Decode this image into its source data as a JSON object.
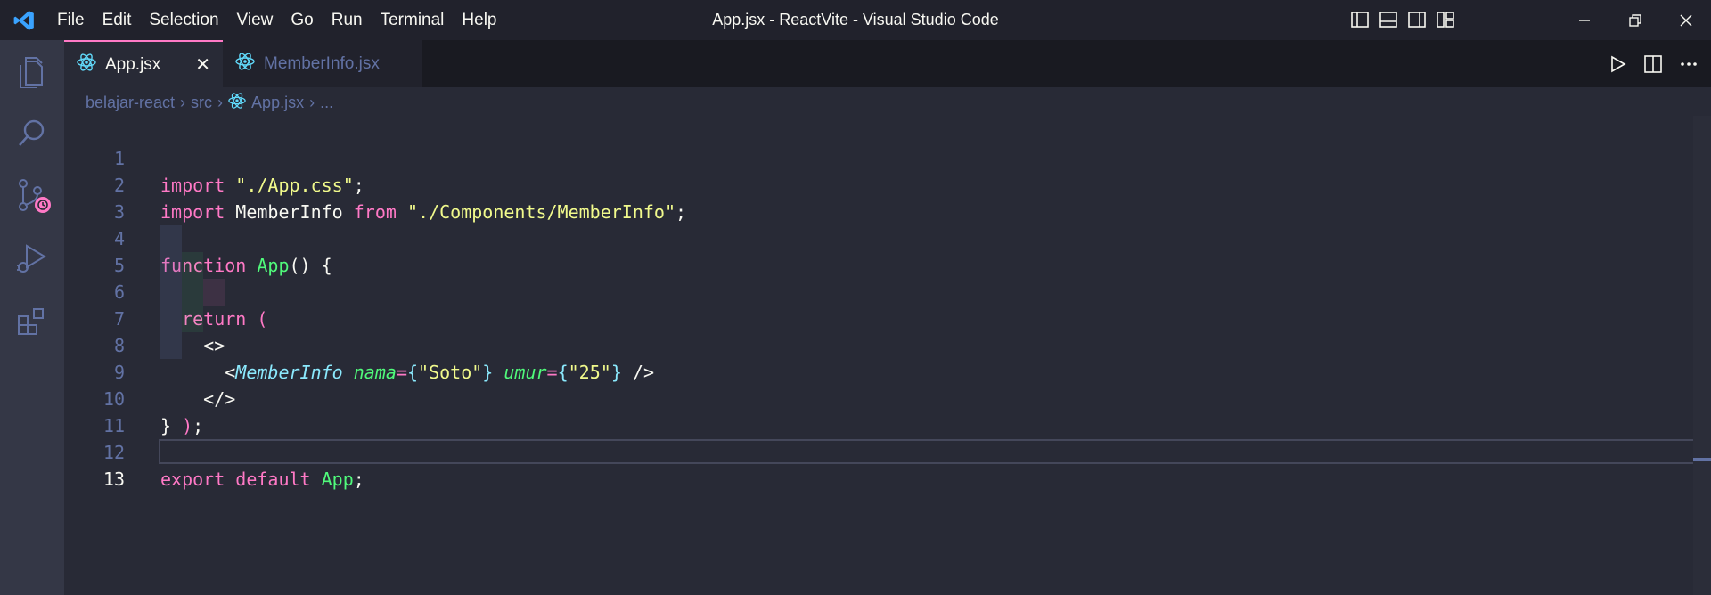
{
  "window": {
    "title": "App.jsx - ReactVite - Visual Studio Code"
  },
  "menu": [
    "File",
    "Edit",
    "Selection",
    "View",
    "Go",
    "Run",
    "Terminal",
    "Help"
  ],
  "activity_bar": {
    "items": [
      "explorer-icon",
      "search-icon",
      "source-control-icon",
      "run-debug-icon",
      "extensions-icon"
    ]
  },
  "tabs": [
    {
      "label": "App.jsx",
      "active": true,
      "close": "✕"
    },
    {
      "label": "MemberInfo.jsx",
      "active": false
    }
  ],
  "breadcrumb": {
    "items": [
      "belajar-react",
      "src",
      "App.jsx",
      "..."
    ]
  },
  "code": {
    "lines": [
      {
        "n": "1"
      },
      {
        "n": "2"
      },
      {
        "n": "3"
      },
      {
        "n": "4"
      },
      {
        "n": "5"
      },
      {
        "n": "6"
      },
      {
        "n": "7"
      },
      {
        "n": "8"
      },
      {
        "n": "9"
      },
      {
        "n": "10"
      },
      {
        "n": "11"
      },
      {
        "n": "12"
      },
      {
        "n": "13"
      }
    ],
    "tokens": {
      "import": "import",
      "app_css": "\"./App.css\"",
      "semicolon": ";",
      "memberinfo": "MemberInfo",
      "from": "from",
      "components_path": "\"./Components/MemberInfo\"",
      "function": "function",
      "app": "App",
      "parens_brace": "() {",
      "return": "return",
      "open_paren": "(",
      "frag_open": "<>",
      "lt": "<",
      "nama": "nama",
      "eq": "=",
      "lbrace": "{",
      "rbrace": "}",
      "soto": "\"Soto\"",
      "umur": "umur",
      "val25": "\"25\"",
      "self_close": "/>",
      "frag_close": "</>",
      "close_paren": ")",
      "close_brace": "}",
      "export": "export",
      "default": "default"
    }
  },
  "colors": {
    "background": "#282a36",
    "titlebar": "#21222c",
    "activitybar": "#343746",
    "accent": "#ff79c6",
    "comment": "#6272a4"
  }
}
